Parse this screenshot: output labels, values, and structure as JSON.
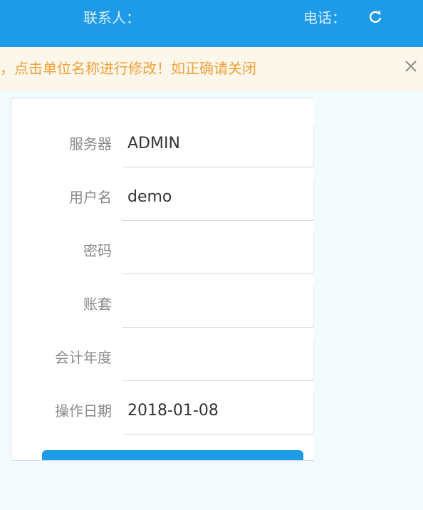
{
  "header": {
    "contact_label": "联系人：",
    "phone_label": "电话：",
    "refresh_icon": "refresh-icon"
  },
  "notice": {
    "text": "，点击单位名称进行修改！如正确请关闭",
    "close_icon": "close-icon"
  },
  "form": {
    "fields": [
      {
        "label": "服务器",
        "value": "ADMIN"
      },
      {
        "label": "用户名",
        "value": "demo"
      },
      {
        "label": "密码",
        "value": ""
      },
      {
        "label": "账套",
        "value": ""
      },
      {
        "label": "会计年度",
        "value": ""
      },
      {
        "label": "操作日期",
        "value": "2018-01-08"
      }
    ]
  },
  "colors": {
    "accent": "#1e9be8",
    "notice_text": "#f0a23a",
    "notice_bg": "#fdf6ea",
    "page_bg": "#f3fbfe"
  }
}
